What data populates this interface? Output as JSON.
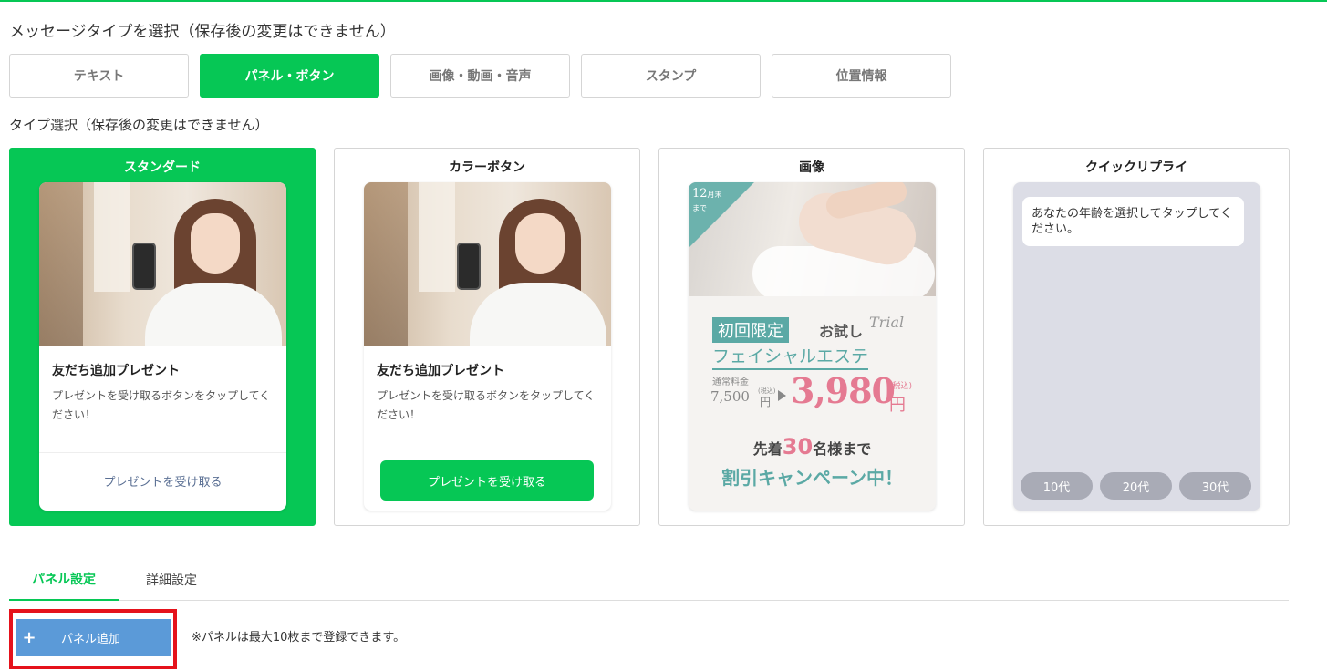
{
  "message_type_heading": "メッセージタイプを選択（保存後の変更はできません）",
  "message_tabs": [
    {
      "label": "テキスト",
      "active": false
    },
    {
      "label": "パネル・ボタン",
      "active": true
    },
    {
      "label": "画像・動画・音声",
      "active": false
    },
    {
      "label": "スタンプ",
      "active": false
    },
    {
      "label": "位置情報",
      "active": false
    }
  ],
  "type_heading": "タイプ選択（保存後の変更はできません）",
  "cards": {
    "standard": {
      "title": "スタンダード",
      "item_title": "友だち追加プレゼント",
      "item_desc": "プレゼントを受け取るボタンをタップしてください！",
      "link_label": "プレゼントを受け取る"
    },
    "color_button": {
      "title": "カラーボタン",
      "item_title": "友だち追加プレゼント",
      "item_desc": "プレゼントを受け取るボタンをタップしてください！",
      "button_label": "プレゼントを受け取る"
    },
    "image": {
      "title": "画像",
      "date_num": "12",
      "date_unit": "月末",
      "date_suffix": "まで",
      "badge": "初回限定",
      "trial": "お試し",
      "trial_script": "Trial",
      "facial": "フェイシャルエステ",
      "regular_label": "通常料金",
      "old_price": "7,500",
      "tax_label": "(税込)",
      "yen": "円",
      "new_price": "3,980",
      "first_prefix": "先着",
      "first_num": "30",
      "first_suffix": "名様まで",
      "campaign": "割引キャンペーン中！"
    },
    "quick_reply": {
      "title": "クイックリプライ",
      "bubble": "あなたの年齢を選択してタップしてください。",
      "chips": [
        "10代",
        "20代",
        "30代"
      ]
    }
  },
  "settings_tabs": {
    "panel": "パネル設定",
    "detail": "詳細設定"
  },
  "add_panel": {
    "plus": "+",
    "label": "パネル追加",
    "note": "※パネルは最大10枚まで登録できます。"
  },
  "colors": {
    "accent": "#06c755",
    "add_button": "#5b9ad8",
    "highlight": "#e5121b"
  }
}
